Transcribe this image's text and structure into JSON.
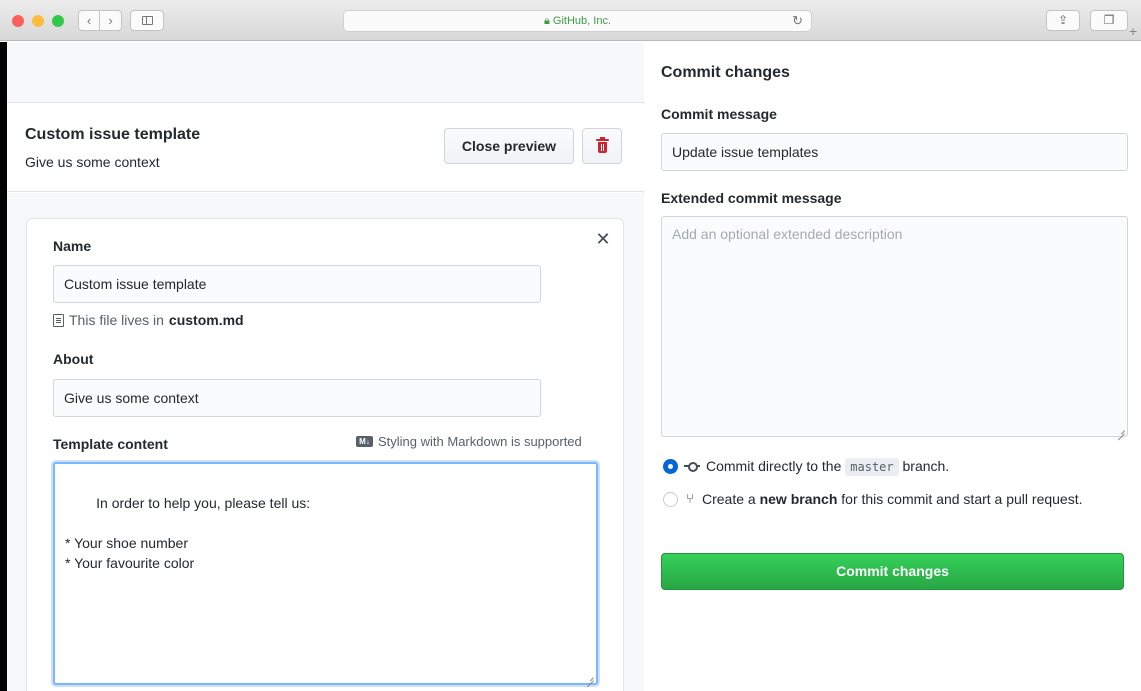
{
  "browser": {
    "address": "GitHub, Inc.",
    "lights": [
      "#fc605c",
      "#fdbc40",
      "#34c84a"
    ],
    "back_icon": "chevron-left-icon",
    "forward_icon": "chevron-right-icon",
    "reload_icon": "reload-icon",
    "share_icon": "share-icon",
    "tabs_icon": "tabs-icon",
    "lock_icon": "lock-icon"
  },
  "template_header": {
    "title": "Custom issue template",
    "subtitle": "Give us some context",
    "close_preview_label": "Close preview"
  },
  "template_form": {
    "name_label": "Name",
    "name_value": "Custom issue template",
    "file_note_prefix": "This file lives in",
    "file_name": "custom.md",
    "about_label": "About",
    "about_value": "Give us some context",
    "content_label": "Template content",
    "markdown_note": "Styling with Markdown is supported",
    "content_value": "In order to help you, please tell us:\n\n* Your shoe number\n* Your favourite color"
  },
  "commit": {
    "title": "Commit changes",
    "message_label": "Commit message",
    "message_value": "Update issue templates",
    "extended_label": "Extended commit message",
    "extended_placeholder": "Add an optional extended description",
    "option_direct_prefix": "Commit directly to the",
    "option_direct_branch": "master",
    "option_direct_suffix": "branch.",
    "option_new_prefix": "Create a",
    "option_new_bold": "new branch",
    "option_new_suffix": "for this commit and start a pull request.",
    "selected_option": "direct",
    "button_label": "Commit changes"
  },
  "colors": {
    "accent_blue": "#0366d6",
    "commit_green": "#28a745",
    "delete_red": "#cb2431"
  }
}
